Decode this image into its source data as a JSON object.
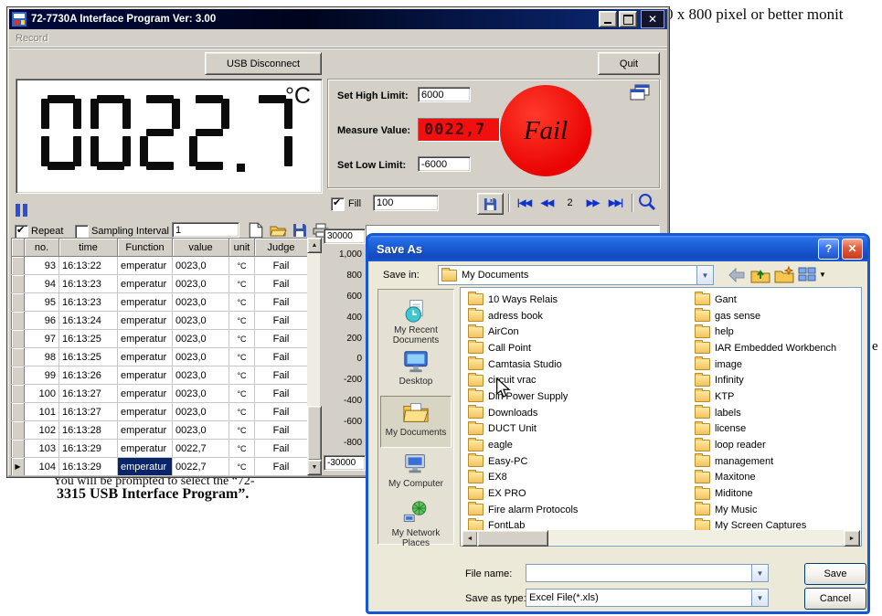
{
  "background": {
    "top_fragment": "0 x 800 pixel or better monit",
    "sentence_fragment": "You will be prompted to select the “72-",
    "bold_fragment": "3315 USB Interface Program”.",
    "edge_fragment": "e"
  },
  "main_window": {
    "title": "72-7730A Interface Program Ver: 3.00",
    "menu": [
      "Record"
    ],
    "usb_button": "USB Disconnect",
    "quit_button": "Quit",
    "lcd": {
      "value": "0022.7",
      "unit": "°C"
    },
    "limits": {
      "high_label": "Set High Limit:",
      "high_value": "6000",
      "measure_label": "Measure Value:",
      "measure_value": "0022,7",
      "low_label": "Set Low Limit:",
      "low_value": "-6000",
      "status": "Fail"
    },
    "fill": {
      "label": "Fill",
      "value": "100",
      "page": "2",
      "nav_first": "|◀◀",
      "nav_prev": "◀◀",
      "nav_next": "▶▶",
      "nav_last": "▶▶|"
    },
    "controls": {
      "repeat_label": "Repeat",
      "sampling_label": "Sampling Interval",
      "sampling_value": "1"
    },
    "table": {
      "headers": [
        "no.",
        "time",
        "Function",
        "value",
        "unit",
        "Judge"
      ],
      "rows": [
        [
          "93",
          "16:13:22",
          "emperatur",
          "0023,0",
          "°C",
          "Fail"
        ],
        [
          "94",
          "16:13:23",
          "emperatur",
          "0023,0",
          "°C",
          "Fail"
        ],
        [
          "95",
          "16:13:23",
          "emperatur",
          "0023,0",
          "°C",
          "Fail"
        ],
        [
          "96",
          "16:13:24",
          "emperatur",
          "0023,0",
          "°C",
          "Fail"
        ],
        [
          "97",
          "16:13:25",
          "emperatur",
          "0023,0",
          "°C",
          "Fail"
        ],
        [
          "98",
          "16:13:25",
          "emperatur",
          "0023,0",
          "°C",
          "Fail"
        ],
        [
          "99",
          "16:13:26",
          "emperatur",
          "0023,0",
          "°C",
          "Fail"
        ],
        [
          "100",
          "16:13:27",
          "emperatur",
          "0023,0",
          "°C",
          "Fail"
        ],
        [
          "101",
          "16:13:27",
          "emperatur",
          "0023,0",
          "°C",
          "Fail"
        ],
        [
          "102",
          "16:13:28",
          "emperatur",
          "0023,0",
          "°C",
          "Fail"
        ],
        [
          "103",
          "16:13:29",
          "emperatur",
          "0022,7",
          "°C",
          "Fail"
        ],
        [
          "104",
          "16:13:29",
          "emperatur",
          "0022,7",
          "°C",
          "Fail"
        ]
      ]
    },
    "chart": {
      "max_value": "30000",
      "min_value": "-30000",
      "y_labels": [
        "1,000",
        "800",
        "600",
        "400",
        "200",
        "0",
        "-200",
        "-400",
        "-600",
        "-800"
      ]
    }
  },
  "save_dialog": {
    "title": "Save As",
    "save_in_label": "Save in:",
    "save_in_value": "My Documents",
    "places": [
      "My Recent Documents",
      "Desktop",
      "My Documents",
      "My Computer",
      "My Network Places"
    ],
    "folders_col1": [
      "10 Ways Relais",
      "adress book",
      "AirCon",
      "Call Point",
      "Camtasia Studio",
      "circuit vrac",
      "Din Power Supply",
      "Downloads",
      "DUCT Unit",
      "eagle",
      "Easy-PC",
      "EX8",
      "EX PRO",
      "Fire alarm Protocols",
      "FontLab"
    ],
    "folders_col2": [
      "Gant",
      "gas sense",
      "help",
      "IAR Embedded Workbench",
      "image",
      "Infinity",
      "KTP",
      "labels",
      "license",
      "loop reader",
      "management",
      "Maxitone",
      "Miditone",
      "My Music",
      "My Screen Captures"
    ],
    "file_name_label": "File name:",
    "file_name_value": "",
    "save_as_type_label": "Save as type:",
    "save_as_type_value": "Excel File(*.xls)",
    "save_button": "Save",
    "cancel_button": "Cancel"
  },
  "colors": {
    "titlebar_dark_blue": "#0A246A",
    "xp_blue": "#1C5ED6",
    "fail_red": "#EA0404",
    "measure_red": "#F01010",
    "nav_blue": "#1133CC",
    "folder_yellow": "#F2C25E",
    "window_gray": "#D4D0C8"
  }
}
